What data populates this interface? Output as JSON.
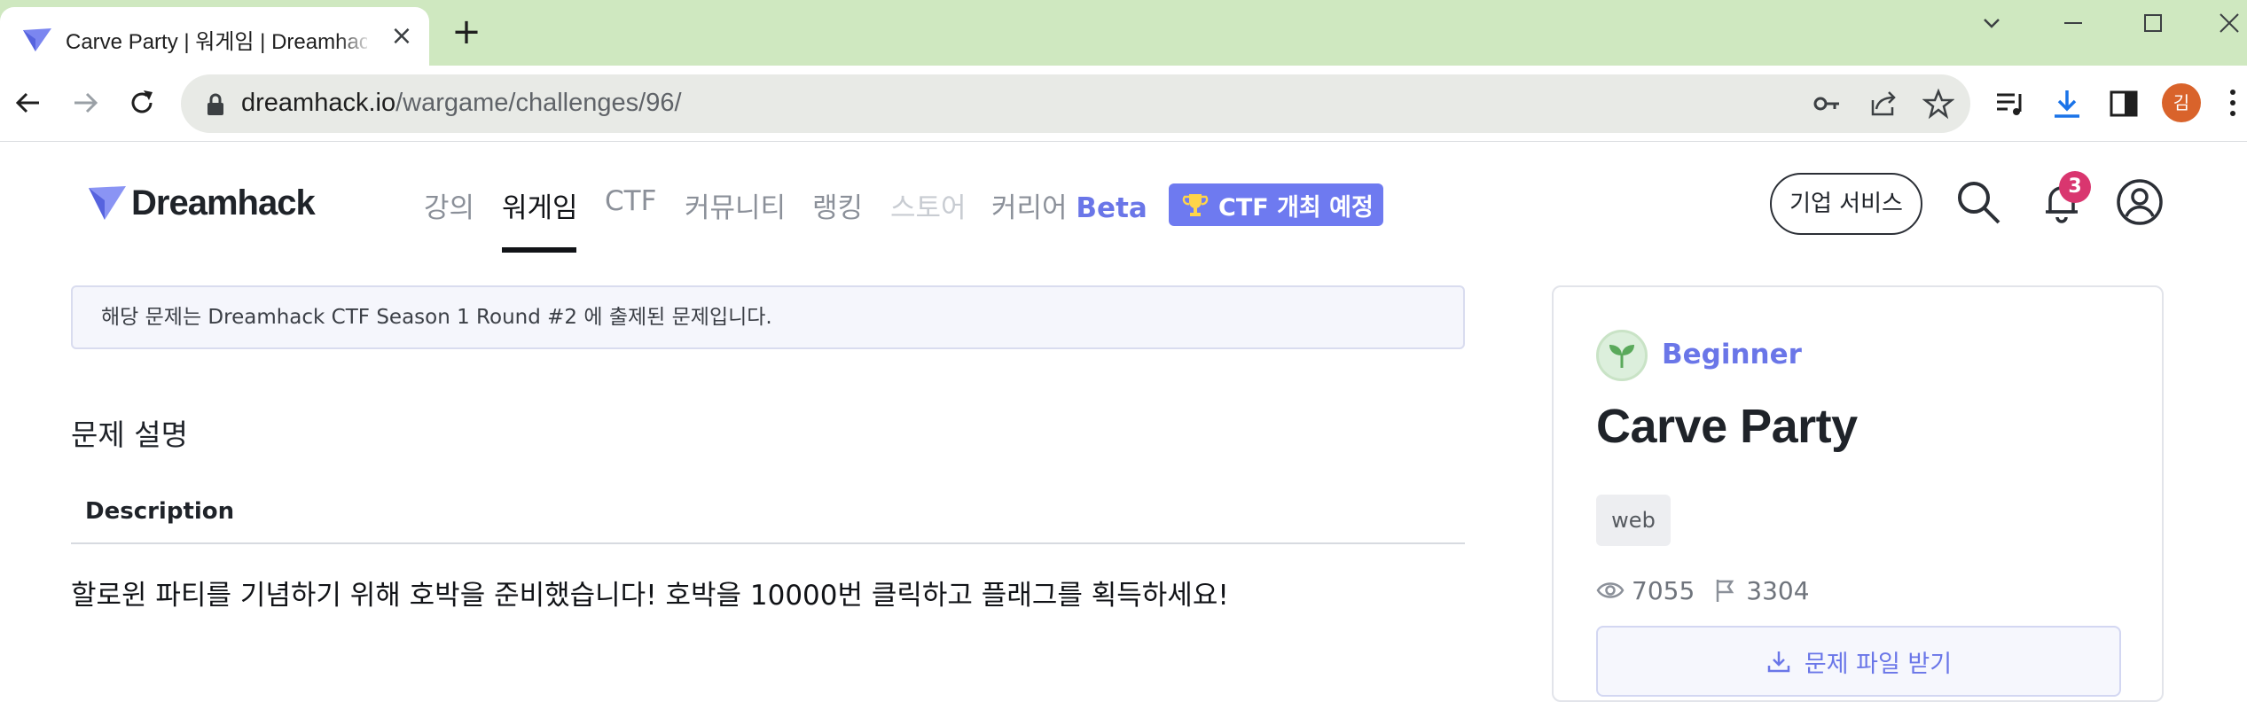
{
  "browser": {
    "tab_title": "Carve Party | 워게임 | Dreamhack",
    "url_host": "dreamhack.io",
    "url_path": "/wargame/challenges/96/",
    "profile_initial": "김"
  },
  "header": {
    "logo_text": "Dreamhack",
    "nav": [
      {
        "label": "강의"
      },
      {
        "label": "워게임"
      },
      {
        "label": "CTF"
      },
      {
        "label": "커뮤니티"
      },
      {
        "label": "랭킹"
      },
      {
        "label": "스토어"
      },
      {
        "label": "커리어",
        "badge": "Beta"
      }
    ],
    "ctf_badge": "CTF 개최 예정",
    "enterprise_button": "기업 서비스",
    "notification_count": "3"
  },
  "main": {
    "notice": "해당 문제는 Dreamhack CTF Season 1 Round #2 에 출제된 문제입니다.",
    "section_title": "문제 설명",
    "description_heading": "Description",
    "description_body": "할로윈 파티를 기념하기 위해 호박을 준비했습니다! 호박을 10000번 클릭하고 플래그를 획득하세요!"
  },
  "card": {
    "level": "Beginner",
    "title": "Carve Party",
    "tag": "web",
    "views": "7055",
    "solves": "3304",
    "download_button": "문제 파일 받기"
  },
  "colors": {
    "tabbar_bg": "#cfe8c0",
    "accent": "#6e7af0",
    "notification": "#d9366f",
    "profile": "#d9632b"
  }
}
